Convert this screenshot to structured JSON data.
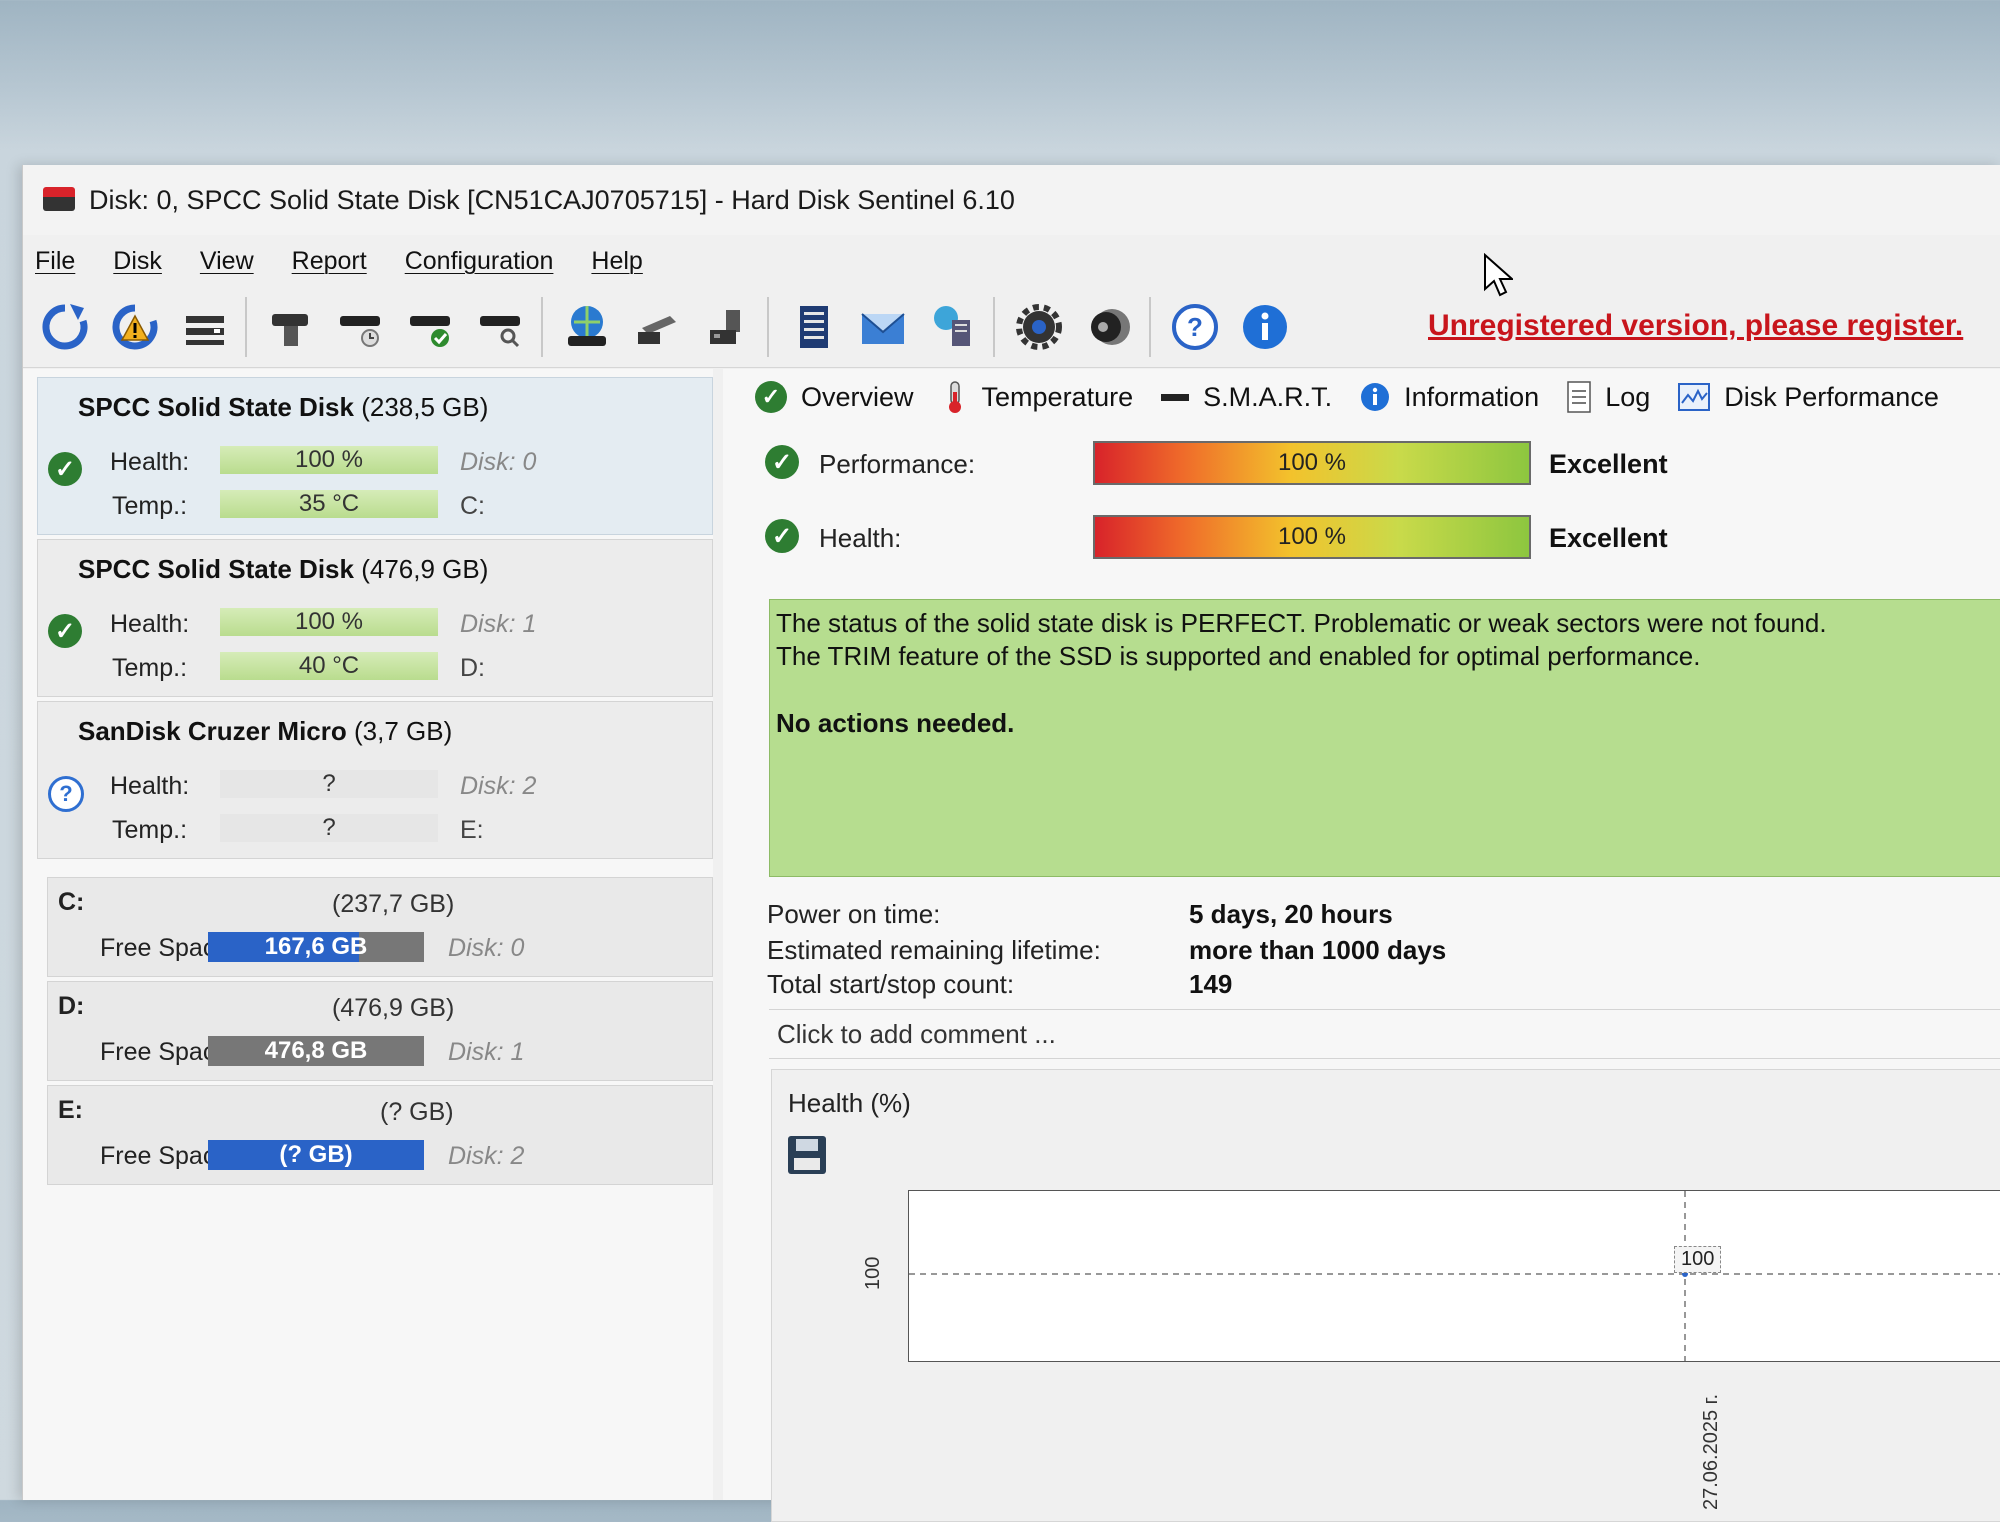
{
  "window": {
    "title": "Disk: 0, SPCC Solid State Disk [CN51CAJ0705715]  -  Hard Disk Sentinel 6.10"
  },
  "menu": [
    "File",
    "Disk",
    "View",
    "Report",
    "Configuration",
    "Help"
  ],
  "toolbar": {
    "register_link": "Unregistered version, please register."
  },
  "disks": [
    {
      "name": "SPCC Solid State Disk",
      "size": "(238,5 GB)",
      "health_label": "Health:",
      "health": "100 %",
      "health_fraction": 1.0,
      "temp_label": "Temp.:",
      "temp": "35 °C",
      "disk": "Disk: 0",
      "letter": "C:"
    },
    {
      "name": "SPCC Solid State Disk",
      "size": "(476,9 GB)",
      "health_label": "Health:",
      "health": "100 %",
      "health_fraction": 1.0,
      "temp_label": "Temp.:",
      "temp": "40 °C",
      "disk": "Disk: 1",
      "letter": "D:"
    },
    {
      "name": "SanDisk Cruzer Micro",
      "size": "(3,7 GB)",
      "health_label": "Health:",
      "health": "?",
      "temp_label": "Temp.:",
      "temp": "?",
      "disk": "Disk: 2",
      "letter": "E:"
    }
  ],
  "volumes": [
    {
      "letter": "C:",
      "size": "(237,7 GB)",
      "free_label": "Free Space",
      "free": "167,6 GB",
      "disk": "Disk: 0"
    },
    {
      "letter": "D:",
      "size": "(476,9 GB)",
      "free_label": "Free Space",
      "free": "476,8 GB",
      "disk": "Disk: 1"
    },
    {
      "letter": "E:",
      "size": "(? GB)",
      "free_label": "Free Space",
      "free": "(? GB)",
      "disk": "Disk: 2"
    }
  ],
  "tabs": [
    "Overview",
    "Temperature",
    "S.M.A.R.T.",
    "Information",
    "Log",
    "Disk Performance"
  ],
  "overview": {
    "performance_label": "Performance:",
    "performance_value": "100 %",
    "performance_word": "Excellent",
    "health_label": "Health:",
    "health_value": "100 %",
    "health_word": "Excellent",
    "status_line1": "The status of the solid state disk is PERFECT. Problematic or weak sectors were not found.",
    "status_line2": "The TRIM feature of the SSD is supported and enabled for optimal performance.",
    "status_line3": "No actions needed.",
    "power_on_label": "Power on time:",
    "power_on_value": "5 days, 20 hours",
    "lifetime_label": "Estimated remaining lifetime:",
    "lifetime_value": "more than 1000 days",
    "startstop_label": "Total start/stop count:",
    "startstop_value": "149",
    "comment": "Click to add comment ..."
  },
  "chart_data": {
    "type": "line",
    "title": "Health (%)",
    "x": [
      "27.06.2025 г."
    ],
    "series": [
      {
        "values": [
          100
        ]
      }
    ],
    "y_tick": "100",
    "point_label": "100"
  },
  "colors": {
    "accent_blue": "#2a63c7",
    "ok_green": "#2e7d32",
    "status_green": "#b6dd8f",
    "register_red": "#c8151c"
  }
}
